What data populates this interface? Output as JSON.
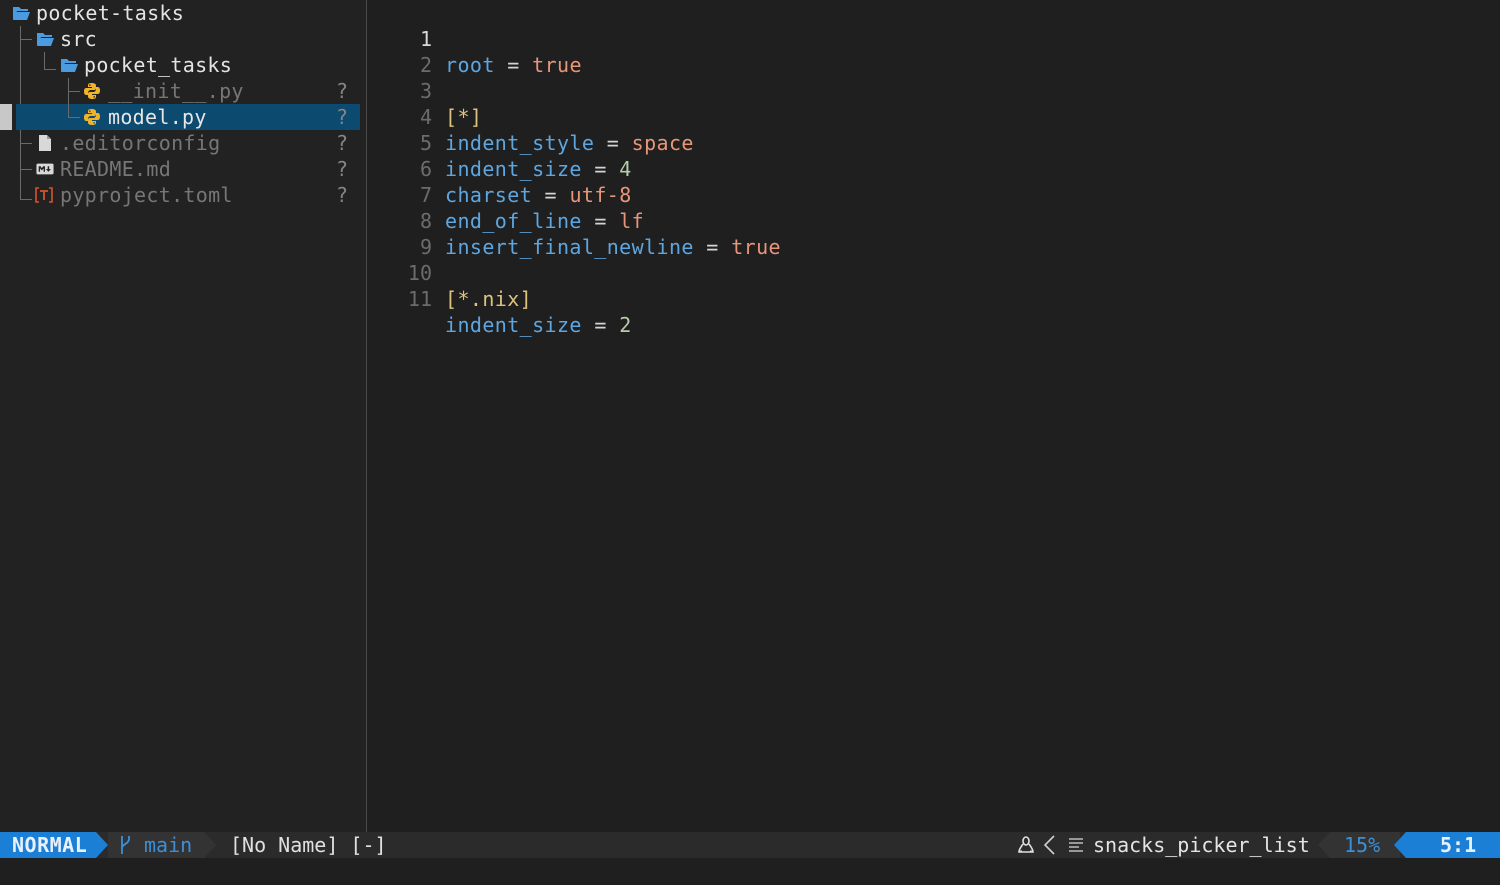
{
  "colors": {
    "accent": "#1b7fd6",
    "selection": "#0c4a70",
    "key": "#5ea6e0",
    "value_keyword": "#e8967a",
    "value_number": "#b5cea8",
    "section": "#dcc37d",
    "folder_icon": "#4a9be0",
    "python_icon": "#f0b429",
    "toml_icon": "#d4542c"
  },
  "tree": {
    "root": "pocket-tasks",
    "items": [
      {
        "name": "src",
        "icon": "folder-open-icon"
      },
      {
        "name": "pocket_tasks",
        "icon": "folder-open-icon"
      },
      {
        "name": "__init__.py",
        "icon": "python-icon",
        "status": "?"
      },
      {
        "name": "model.py",
        "icon": "python-icon",
        "status": "?"
      },
      {
        "name": ".editorconfig",
        "icon": "file-icon",
        "status": "?"
      },
      {
        "name": "README.md",
        "icon": "markdown-icon",
        "status": "?"
      },
      {
        "name": "pyproject.toml",
        "icon": "toml-icon",
        "status": "?"
      }
    ]
  },
  "editor": {
    "lines": [
      {
        "n": "1",
        "key": "root",
        "op": "=",
        "val": "true"
      },
      {
        "n": "2"
      },
      {
        "n": "3",
        "section": "[*]"
      },
      {
        "n": "4",
        "key": "indent_style",
        "op": "=",
        "val": "space"
      },
      {
        "n": "5",
        "key": "indent_size",
        "op": "=",
        "val": "4"
      },
      {
        "n": "6",
        "key": "charset",
        "op": "=",
        "val": "utf-8"
      },
      {
        "n": "7",
        "key": "end_of_line",
        "op": "=",
        "val": "lf"
      },
      {
        "n": "8",
        "key": "insert_final_newline",
        "op": "=",
        "val": "true"
      },
      {
        "n": "9"
      },
      {
        "n": "10",
        "section": "[*.nix]"
      },
      {
        "n": "11",
        "key": "indent_size",
        "op": "=",
        "val": "2"
      }
    ]
  },
  "statusline": {
    "mode": "NORMAL",
    "branch": "main",
    "buffer": "[No Name] [-]",
    "filetype": "snacks_picker_list",
    "percent": "15%",
    "position": "5:1"
  }
}
